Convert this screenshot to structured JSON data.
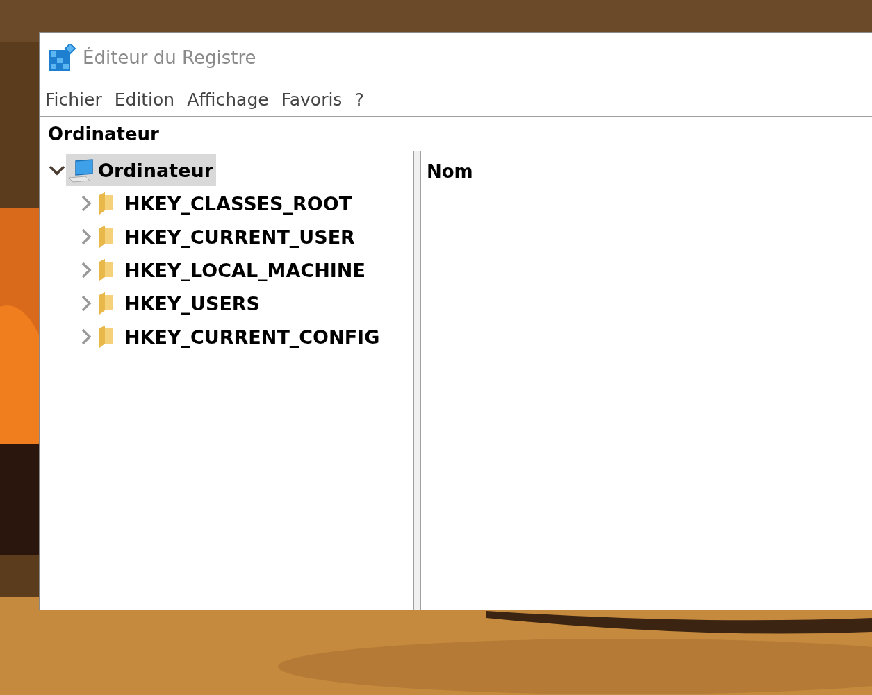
{
  "window": {
    "title": "Éditeur du Registre"
  },
  "menu": [
    "Fichier",
    "Edition",
    "Affichage",
    "Favoris",
    "?"
  ],
  "address": "Ordinateur",
  "tree": {
    "label": "Ordinateur",
    "expanded": true,
    "selected": true,
    "children": [
      {
        "label": "HKEY_CLASSES_ROOT",
        "expanded": false,
        "selected": false
      },
      {
        "label": "HKEY_CURRENT_USER",
        "expanded": false,
        "selected": false
      },
      {
        "label": "HKEY_LOCAL_MACHINE",
        "expanded": false,
        "selected": false
      },
      {
        "label": "HKEY_USERS",
        "expanded": false,
        "selected": false
      },
      {
        "label": "HKEY_CURRENT_CONFIG",
        "expanded": false,
        "selected": false
      }
    ]
  },
  "list": {
    "columns": [
      "Nom"
    ]
  }
}
